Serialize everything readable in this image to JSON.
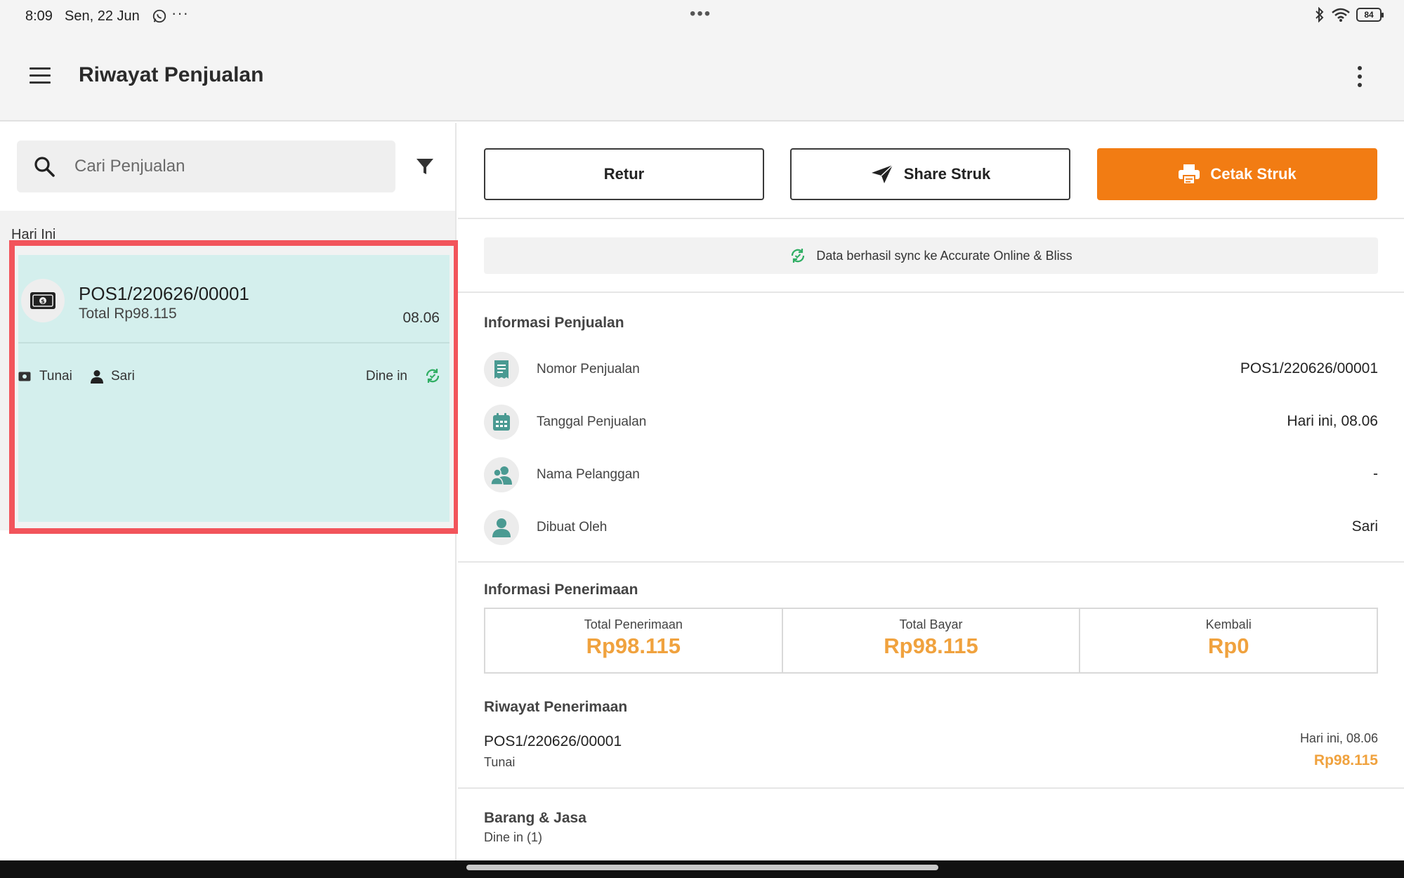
{
  "status_bar": {
    "time": "8:09",
    "date": "Sen, 22 Jun",
    "more": "···",
    "center": "•••",
    "battery": "84"
  },
  "app_bar": {
    "title": "Riwayat Penjualan"
  },
  "left_panel": {
    "search_placeholder": "Cari Penjualan",
    "day_label": "Hari Ini",
    "sale_card": {
      "number": "POS1/220626/00001",
      "total": "Total Rp98.115",
      "time": "08.06",
      "payment_method": "Tunai",
      "cashier": "Sari",
      "order_type": "Dine in"
    }
  },
  "actions": {
    "retur": "Retur",
    "share": "Share Struk",
    "print": "Cetak Struk"
  },
  "sync_banner": "Data berhasil sync ke Accurate Online & Bliss",
  "sales_info": {
    "title": "Informasi Penjualan",
    "rows": [
      {
        "label": "Nomor Penjualan",
        "value": "POS1/220626/00001",
        "icon": "receipt-icon"
      },
      {
        "label": "Tanggal Penjualan",
        "value": "Hari ini, 08.06",
        "icon": "calendar-icon"
      },
      {
        "label": "Nama Pelanggan",
        "value": "-",
        "icon": "customers-icon"
      },
      {
        "label": "Dibuat Oleh",
        "value": "Sari",
        "icon": "person-icon"
      }
    ]
  },
  "receipt_info": {
    "title": "Informasi Penerimaan",
    "cells": [
      {
        "label": "Total Penerimaan",
        "value": "Rp98.115"
      },
      {
        "label": "Total Bayar",
        "value": "Rp98.115"
      },
      {
        "label": "Kembali",
        "value": "Rp0"
      }
    ]
  },
  "receipt_history": {
    "title": "Riwayat Penerimaan",
    "entry": {
      "id": "POS1/220626/00001",
      "method": "Tunai",
      "date": "Hari ini, 08.06",
      "amount": "Rp98.115"
    }
  },
  "goods": {
    "title": "Barang & Jasa",
    "subtitle": "Dine in (1)"
  },
  "colors": {
    "accent": "#f27c13",
    "teal": "#4a9a92",
    "amount": "#f0a23e",
    "highlight": "#f2545b",
    "card_bg": "#d4efed",
    "sync_green": "#2fae63"
  }
}
